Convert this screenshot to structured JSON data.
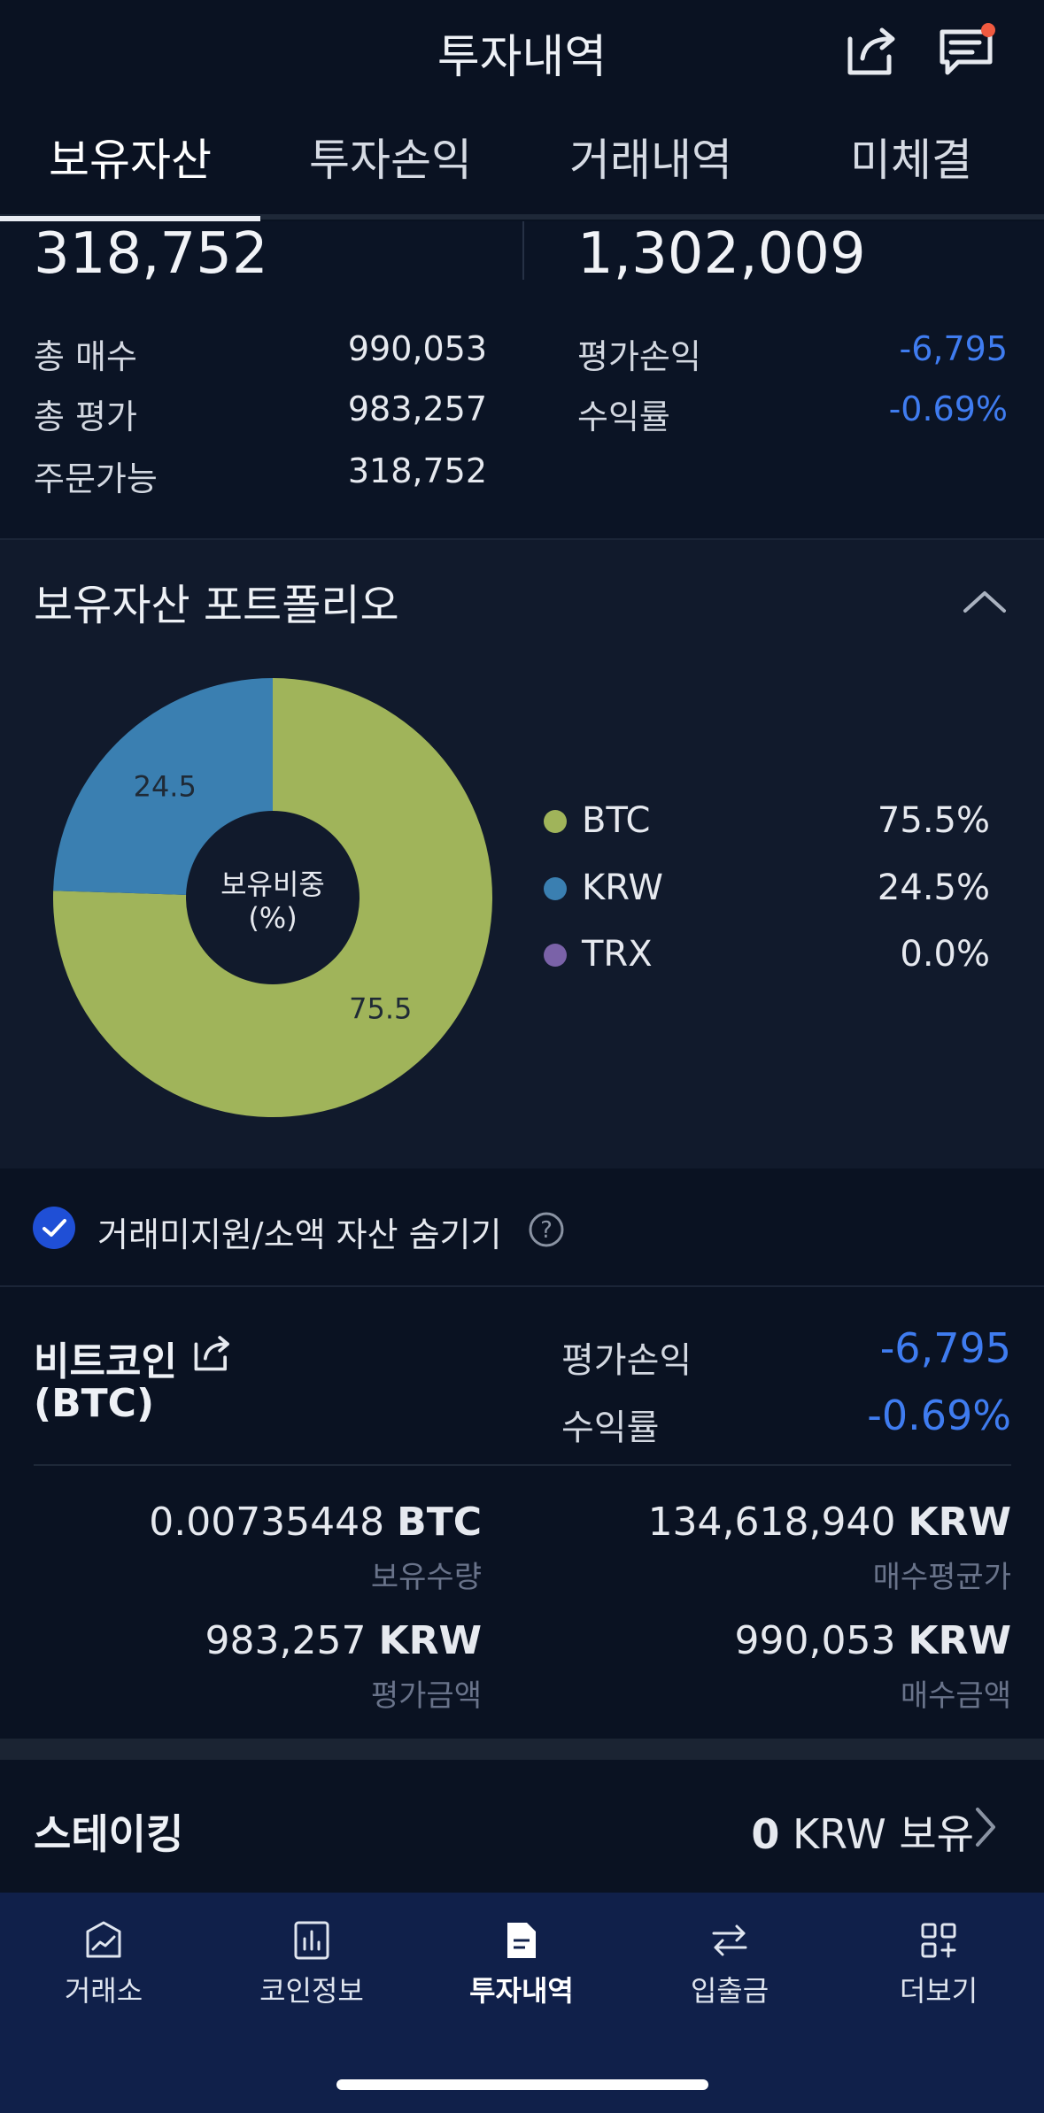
{
  "header": {
    "title": "투자내역"
  },
  "tabs": [
    {
      "label": "보유자산"
    },
    {
      "label": "투자손익"
    },
    {
      "label": "거래내역"
    },
    {
      "label": "미체결"
    }
  ],
  "summary": {
    "left_big": "318,752",
    "right_big": "1,302,009",
    "rows_left": [
      {
        "label": "총 매수",
        "value": "990,053"
      },
      {
        "label": "총 평가",
        "value": "983,257"
      },
      {
        "label": "주문가능",
        "value": "318,752"
      }
    ],
    "rows_right": [
      {
        "label": "평가손익",
        "value": "-6,795"
      },
      {
        "label": "수익률",
        "value": "-0.69%"
      }
    ]
  },
  "portfolio": {
    "title": "보유자산 포트폴리오",
    "center_label_1": "보유비중",
    "center_label_2": "(%)",
    "slice_labels": [
      "24.5",
      "75.5"
    ],
    "legend": [
      {
        "name": "BTC",
        "pct": "75.5%",
        "color": "#a0b45a"
      },
      {
        "name": "KRW",
        "pct": "24.5%",
        "color": "#3a7fb1"
      },
      {
        "name": "TRX",
        "pct": "0.0%",
        "color": "#7a62a8"
      }
    ]
  },
  "chart_data": {
    "type": "pie",
    "categories": [
      "BTC",
      "KRW",
      "TRX"
    ],
    "values": [
      75.5,
      24.5,
      0.0
    ],
    "colors": [
      "#a0b45a",
      "#3a7fb1",
      "#7a62a8"
    ],
    "title": "보유자산 포트폴리오",
    "legend": "right"
  },
  "hide_small": {
    "label": "거래미지원/소액 자산 숨기기",
    "checked": true
  },
  "coin": {
    "name": "비트코인",
    "ticker": "(BTC)",
    "pl_label": "평가손익",
    "pl_value": "-6,795",
    "rate_label": "수익률",
    "rate_value": "-0.69%",
    "holdings_value": "0.00735448",
    "holdings_unit": "BTC",
    "holdings_label": "보유수량",
    "avg_value": "134,618,940",
    "avg_unit": "KRW",
    "avg_label": "매수평균가",
    "eval_value": "983,257",
    "eval_unit": "KRW",
    "eval_label": "평가금액",
    "buy_value": "990,053",
    "buy_unit": "KRW",
    "buy_label": "매수금액"
  },
  "staking": {
    "title": "스테이킹",
    "amount": "0",
    "unit_text": "KRW 보유"
  },
  "nav": [
    {
      "label": "거래소",
      "icon": "exchange-chart-icon"
    },
    {
      "label": "코인정보",
      "icon": "bar-chart-icon"
    },
    {
      "label": "투자내역",
      "icon": "document-icon"
    },
    {
      "label": "입출금",
      "icon": "transfer-arrows-icon"
    },
    {
      "label": "더보기",
      "icon": "grid-plus-icon"
    }
  ]
}
